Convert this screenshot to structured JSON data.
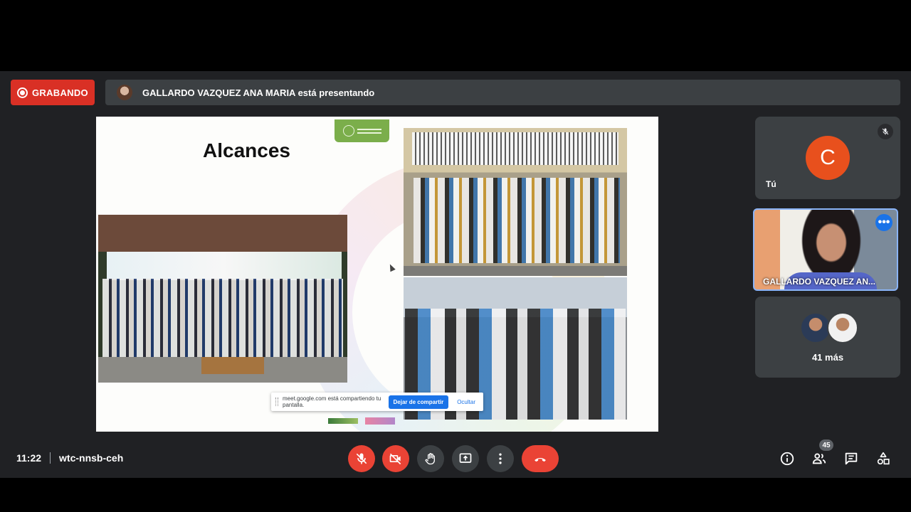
{
  "recording": {
    "label": "GRABANDO"
  },
  "presenter_bar": {
    "text": "GALLARDO VAZQUEZ ANA MARIA está presentando"
  },
  "slide": {
    "title": "Alcances",
    "share_notice": {
      "message": "meet.google.com está compartiendo tu pantalla.",
      "stop_label": "Dejar de compartir",
      "hide_label": "Ocultar"
    }
  },
  "tiles": {
    "self": {
      "initial": "C",
      "name": "Tú"
    },
    "presenter": {
      "name": "GALLARDO VAZQUEZ AN..."
    },
    "others": {
      "label": "41 más"
    }
  },
  "meeting": {
    "time": "11:22",
    "code": "wtc-nnsb-ceh"
  },
  "participants": {
    "count": "45"
  },
  "colors": {
    "recording_red": "#d93025",
    "end_call_red": "#ea4335",
    "active_border": "#8ab4f8",
    "avatar_orange": "#e8501d"
  }
}
